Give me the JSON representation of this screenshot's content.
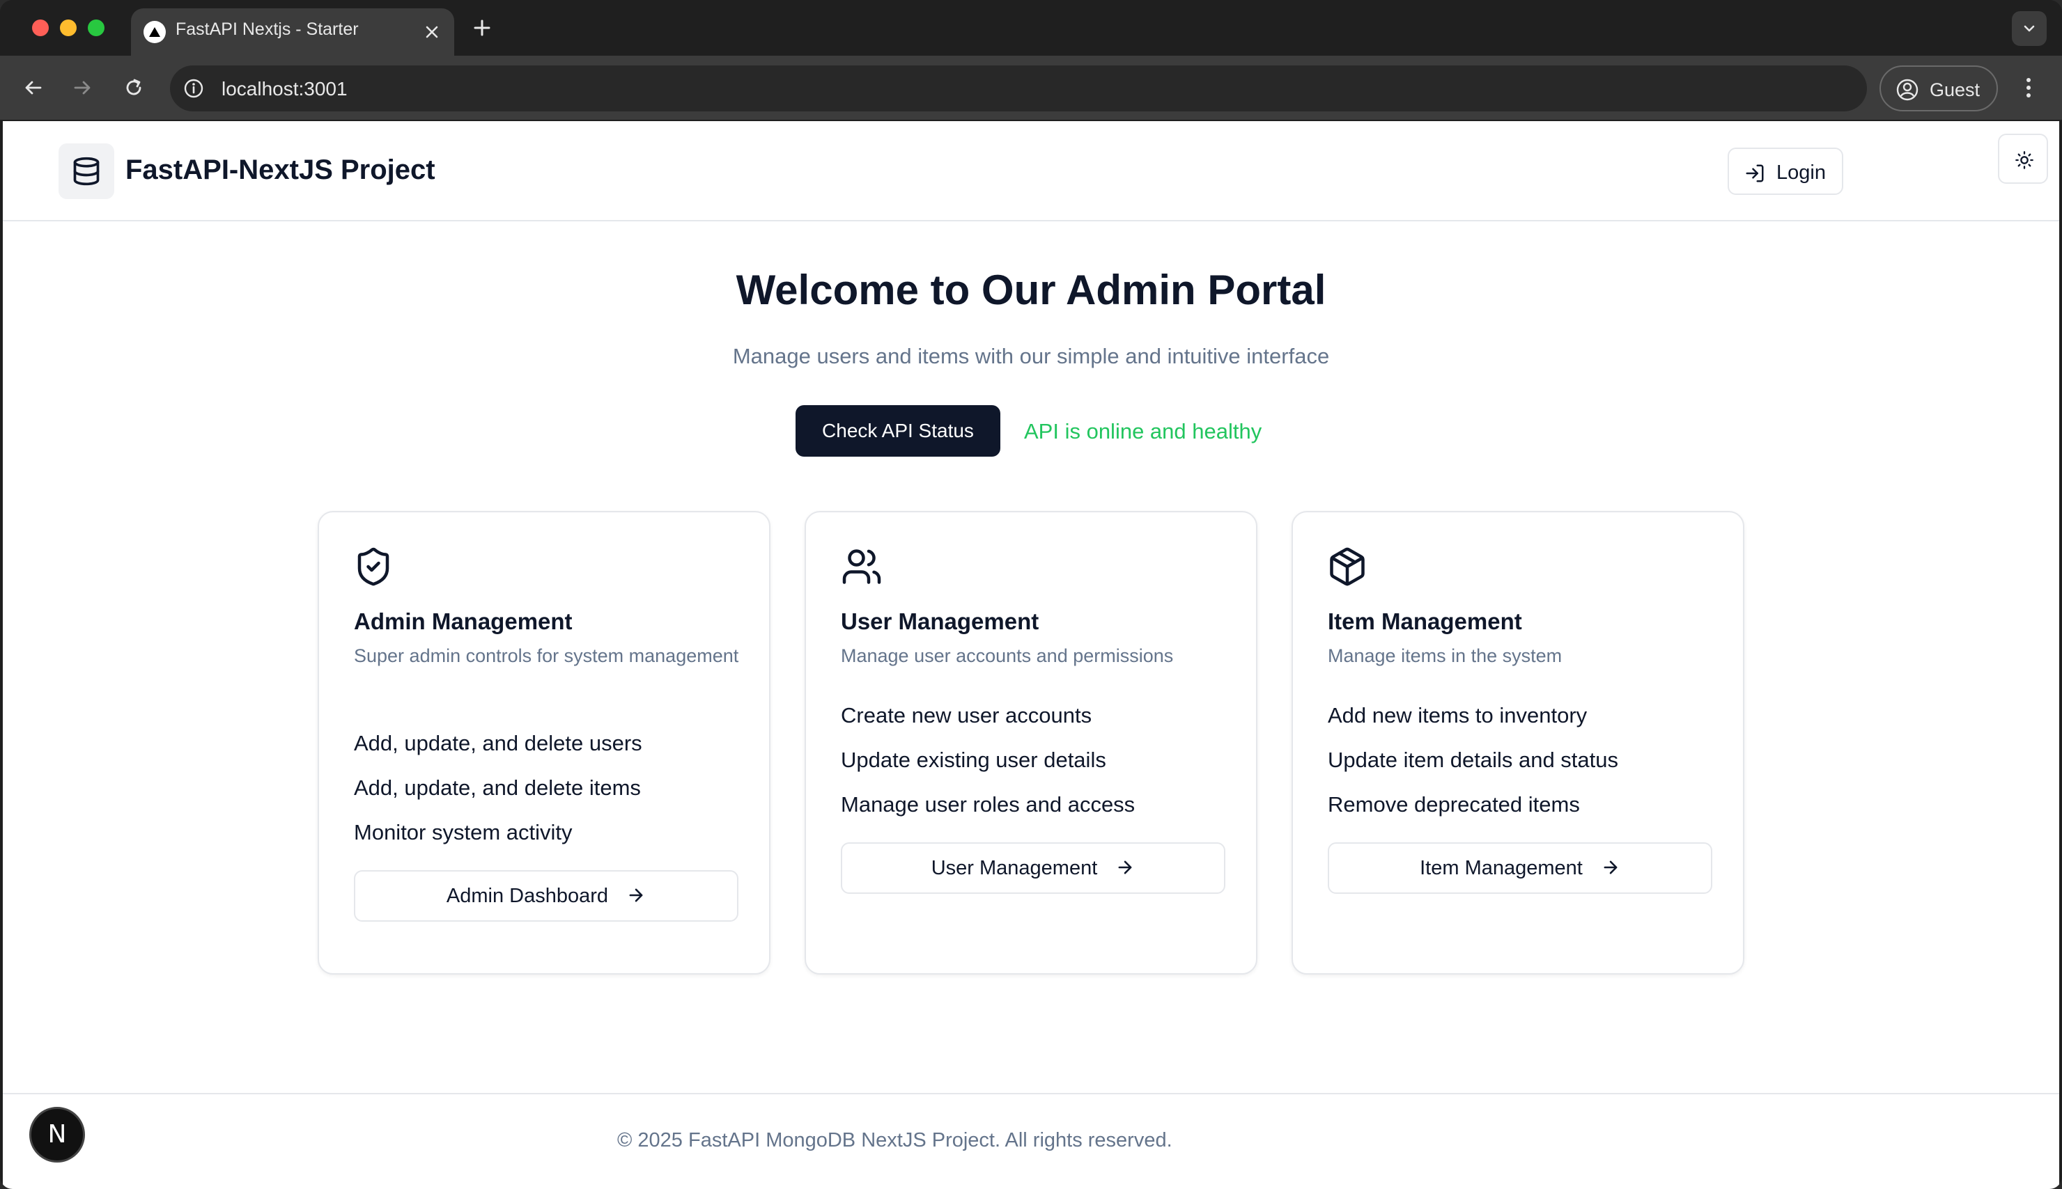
{
  "browser": {
    "tab_title": "FastAPI Nextjs - Starter",
    "url": "localhost:3001",
    "profile_label": "Guest"
  },
  "header": {
    "app_title": "FastAPI-NextJS Project",
    "login_label": "Login"
  },
  "hero": {
    "title": "Welcome to Our Admin Portal",
    "subtitle": "Manage users and items with our simple and intuitive interface",
    "api_button_label": "Check API Status",
    "api_status_text": "API is online and healthy"
  },
  "cards": [
    {
      "icon": "shield-check-icon",
      "title": "Admin Management",
      "description": "Super admin controls for system management",
      "features": [
        "Add, update, and delete users",
        "Add, update, and delete items",
        "Monitor system activity"
      ],
      "button_label": "Admin Dashboard"
    },
    {
      "icon": "users-icon",
      "title": "User Management",
      "description": "Manage user accounts and permissions",
      "features": [
        "Create new user accounts",
        "Update existing user details",
        "Manage user roles and access"
      ],
      "button_label": "User Management"
    },
    {
      "icon": "package-icon",
      "title": "Item Management",
      "description": "Manage items in the system",
      "features": [
        "Add new items to inventory",
        "Update item details and status",
        "Remove deprecated items"
      ],
      "button_label": "Item Management"
    }
  ],
  "footer": {
    "text": "© 2025 FastAPI MongoDB NextJS Project. All rights reserved."
  },
  "dev_badge": {
    "letter": "N"
  },
  "colors": {
    "primary": "#0f172a",
    "muted_text": "#64748b",
    "status_ok": "#22c55e",
    "border": "#e5e7eb"
  }
}
